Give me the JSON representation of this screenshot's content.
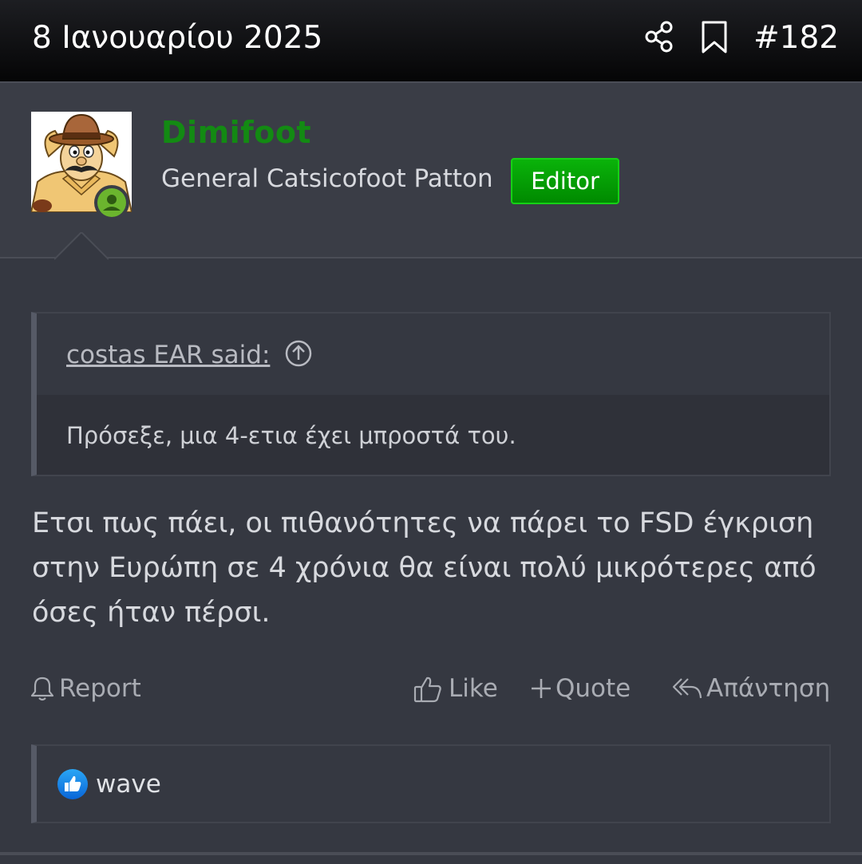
{
  "header": {
    "date": "8 Ιανουαρίου 2025",
    "post_number": "#182",
    "icons": [
      "share-icon",
      "bookmark-icon"
    ]
  },
  "author": {
    "username": "Dimifoot",
    "title": "General Catsicofoot Patton",
    "badge": "Editor",
    "online": true,
    "colors": {
      "username": "#138a13",
      "badge": "#00a000",
      "online": "#6bb52e"
    }
  },
  "quote": {
    "attribution": "costas EAR said:",
    "text": "Πρόσεξε, μια 4-ετια έχει μπροστά του."
  },
  "message": {
    "text": "Ετσι πως πάει, οι πιθανότητες να πάρει το FSD έγκριση στην Ευρώπη σε 4 χρόνια θα είναι πολύ μικρότερες από όσες ήταν πέρσι."
  },
  "actions": {
    "report": "Report",
    "like": "Like",
    "quote": "Quote",
    "reply": "Απάντηση"
  },
  "reactions": {
    "icon": "like-reaction-icon",
    "users": "wave"
  }
}
